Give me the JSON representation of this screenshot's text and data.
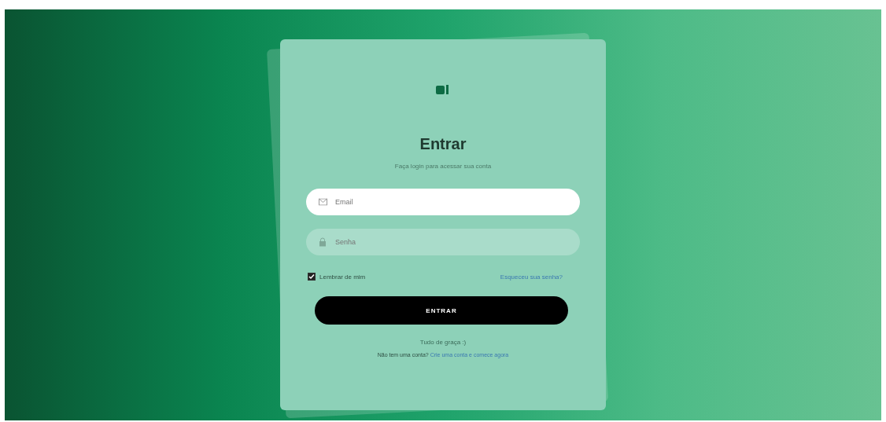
{
  "card": {
    "title": "Entrar",
    "subtitle": "Faça login para acessar sua conta"
  },
  "fields": [
    {
      "kind": "email",
      "placeholder": "Email",
      "focused": true
    },
    {
      "kind": "password",
      "placeholder": "Senha",
      "focused": false
    }
  ],
  "remember": {
    "label": "Lembrar de mim",
    "checked": true
  },
  "forgot_link": "Esqueceu sua senha?",
  "submit": "ENTRAR",
  "note": "Tudo de graça :)",
  "signup": {
    "text": "Não tem uma conta?",
    "link": "Crie uma conta e comece agora"
  }
}
